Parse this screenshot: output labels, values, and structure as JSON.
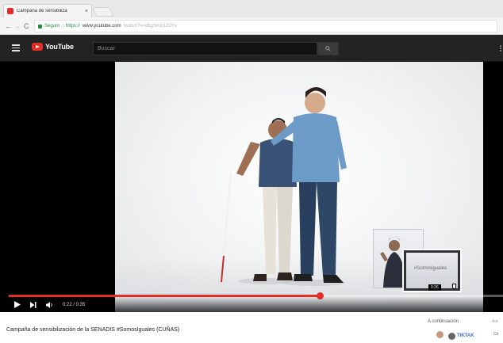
{
  "browser": {
    "tab_title": "Campaña de sensibiliza",
    "tab_close": "×",
    "nav": {
      "back": "←",
      "forward": "→",
      "reload": "C"
    },
    "secure_label": "Seguro",
    "url_scheme": "https://",
    "url_host": "www.youtube.com",
    "url_path": "/watch?v=d6gSmGLEfYs"
  },
  "youtube": {
    "logo_text": "YouTube",
    "search_placeholder": "Buscar"
  },
  "player": {
    "time": "0:22 / 0:35",
    "progress_fraction": 0.63,
    "inset_text": "#Somosiguales",
    "inset_time": "0:26"
  },
  "video": {
    "title": "Campaña de sensibilización de la SENADIS #SomosIguales (CUÑAS)"
  },
  "sidebar": {
    "up_next": "A continuación",
    "autoplay": "Aut",
    "suggestion_brand": "TIKTAK",
    "suggestion_cut": "Có"
  },
  "colors": {
    "brand_red": "#e52d27",
    "header_dark": "#232323",
    "secure_green": "#1e8e3e"
  }
}
